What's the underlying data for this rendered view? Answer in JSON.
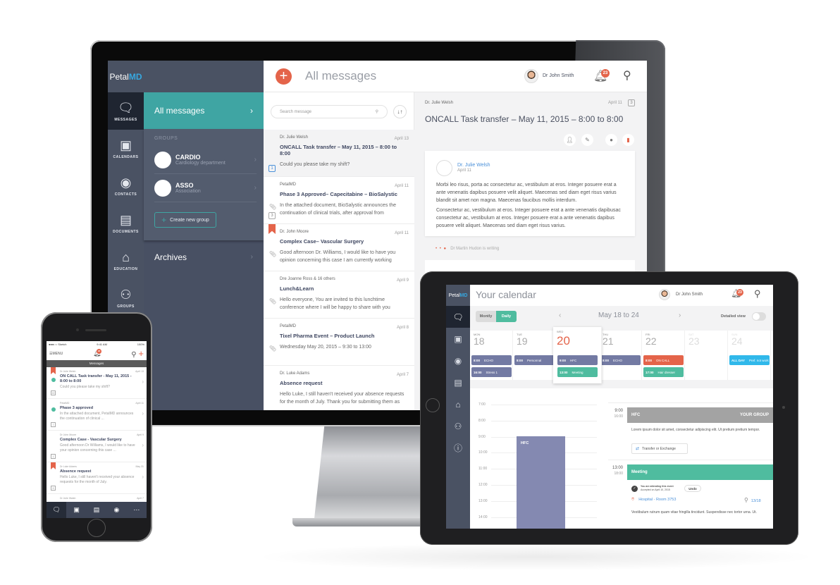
{
  "desktop": {
    "logo": {
      "petal": "Petal",
      "md": "MD"
    },
    "rail": [
      {
        "icon": "chat-bubbles-icon",
        "glyph": "💬",
        "label": "MESSAGES",
        "active": true
      },
      {
        "icon": "calendar-icon",
        "glyph": "📅",
        "label": "CALENDARS"
      },
      {
        "icon": "contact-icon",
        "glyph": "👤",
        "label": "CONTACTS"
      },
      {
        "icon": "document-icon",
        "glyph": "📄",
        "label": "DOCUMENTS"
      },
      {
        "icon": "graduation-cap-icon",
        "glyph": "🎓",
        "label": "EDUCATION"
      },
      {
        "icon": "groups-icon",
        "glyph": "👥",
        "label": "GROUPS"
      }
    ],
    "nav": {
      "all_messages": "All messages",
      "groups_label": "GROUPS",
      "groups": [
        {
          "name": "CARDIO",
          "sub": "Cardiology department"
        },
        {
          "name": "ASSO",
          "sub": "Association"
        }
      ],
      "create_group": "Create new group",
      "archives": "Archives"
    },
    "header": {
      "title": "All messages",
      "user": "Dr John Smith",
      "notifications": "23"
    },
    "list": {
      "search_placeholder": "Search message",
      "messages": [
        {
          "from": "Dr. Julie Welsh",
          "date": "April 13",
          "subject": "ONCALL Task transfer – May 11, 2015 – 8:00 to 8:00",
          "body": "Could you please take my shift?",
          "count": "1",
          "selected": true
        },
        {
          "from": "PetalMD",
          "date": "April 11",
          "subject": "Phase 3 Approved– Capecitabine – BioSalystic",
          "body": "In the attached document, BioSalystic announces the continuation of clinical trials, after approval from",
          "count": "3",
          "attachment": true
        },
        {
          "from": "Dr. John Moore",
          "date": "April 11",
          "subject": "Complex Case– Vascular Surgery",
          "body": "Good afternoon Dr. Williams, I would like to have you opinion concerning this case I am currently working",
          "attachment": true,
          "bookmarked": true
        },
        {
          "from": "Dre Joanne Ross & 16 others",
          "date": "April 9",
          "subject": "Lunch&Learn",
          "body": "Hello everyone, You are invited to this lunchtime conference where  I will be happy to share with you",
          "attachment": true
        },
        {
          "from": "PetalMD",
          "date": "April 8",
          "subject": "Tixel Pharma Event – Product Launch",
          "body": "Wednesday May 20, 2015 – 9:30 to 13:00",
          "attachment": true
        },
        {
          "from": "Dr. Luke Adams",
          "date": "April 7",
          "subject": "Absence request",
          "body": "Hello Luke, I still haven't received your absence requests for the month of July. Thank you for submitting them as"
        }
      ]
    },
    "detail": {
      "from": "Dr. Julie Welsh",
      "date": "April 11",
      "count": "3",
      "title": "ONCALL Task transfer – May 11, 2015 – 8:00 to 8:00",
      "card": {
        "author": "Dr. Julie Welsh",
        "date": "April 11",
        "p1": "Morbi leo risus, porta ac consectetur ac, vestibulum at eros. Integer posuere erat a ante venenatis dapibus posuere velit aliquet. Maecenas sed diam eget risus varius blandit sit amet non magna. Maecenas faucibus mollis interdum.",
        "p2": "Consectetur ac, vestibulum at eros. Integer posuere erat a ante venenatis dapibusac consectetur ac, vestibulum at eros. Integer posuere erat a ante venenatis dapibus posuere velit aliquet. Maecenas sed diam eget risus varius."
      },
      "writing": "Dr Martin Hudon is writing"
    }
  },
  "tablet": {
    "logo": {
      "petal": "Petal",
      "md": "MD"
    },
    "title": "Your calendar",
    "user": "Dr John Smith",
    "notifications": "23",
    "view_toggle": {
      "monthly": "Montly",
      "daily": "Daily",
      "active": "Daily"
    },
    "range": "May 18 to 24",
    "detailed_view": "Detailed view",
    "days": [
      {
        "name": "MON",
        "date": "18",
        "events": [
          {
            "time": "8:00",
            "label": "ECHO",
            "color": "purple"
          },
          {
            "time": "16:00",
            "label": "Stress 1",
            "color": "purple"
          }
        ]
      },
      {
        "name": "TUE",
        "date": "19",
        "events": [
          {
            "time": "8:00",
            "label": "Personnal",
            "color": "purple"
          }
        ]
      },
      {
        "name": "WED",
        "date": "20",
        "today": true,
        "events": [
          {
            "time": "9:00",
            "label": "HFC",
            "color": "purple"
          },
          {
            "time": "13:00",
            "label": "Meeting",
            "color": "green"
          }
        ]
      },
      {
        "name": "THU",
        "date": "21",
        "events": [
          {
            "time": "8:00",
            "label": "ECHO",
            "color": "purple"
          }
        ]
      },
      {
        "name": "FRI",
        "date": "22",
        "events": [
          {
            "time": "8:00",
            "label": "ON CALL",
            "color": "red"
          },
          {
            "time": "17:00",
            "label": "Hair dresser",
            "color": "green"
          }
        ]
      },
      {
        "name": "SAT",
        "date": "23",
        "weekend": true,
        "events": []
      },
      {
        "name": "SUN",
        "date": "24",
        "weekend": true,
        "events": [
          {
            "time": "ALL DAY",
            "label": "Pref. not work",
            "color": "blue"
          }
        ]
      }
    ],
    "hours": [
      "7:00",
      "8:00",
      "9:00",
      "10:00",
      "11:00",
      "12:00",
      "13:00",
      "14:00"
    ],
    "timeline_event": "HFC",
    "agenda": [
      {
        "start": "9:00",
        "end": "16:00",
        "title": "HFC",
        "group": "YOUR GROUP",
        "text": "Lorem ipsum dolor sit amet, consectetur adipiscing elit. Ut pretium pretium tempor.",
        "action": "Transfer or Exchange"
      },
      {
        "start": "13:00",
        "end": "18:00",
        "title": "Meeting",
        "attending": "You are attending this event",
        "accepted": "Accepted on April 10, 2015",
        "undo": "Undo",
        "location": "Hospital - Room 3753",
        "attendees": "13/18",
        "text": "Vestibulum rutrum quam vitae fringilla tincidunt. Suspendisse nec tortor urna. Ut."
      }
    ]
  },
  "phone": {
    "status": {
      "carrier": "●●●○○ Sketch",
      "time": "9:41 AM",
      "battery": "100%"
    },
    "menu": "MENU",
    "notifications": "23",
    "tab_title": "Messages",
    "messages": [
      {
        "from": "Dr Julie Welsh",
        "date": "April 13",
        "subject": "ON CALL Task transfer - May 11, 2015 - 8:00 to 8:00",
        "body": "Could you please take my shift?",
        "count": "22",
        "unread": true,
        "bookmarked": true
      },
      {
        "from": "PetalMD",
        "date": "April 11",
        "subject": "Phase 3 approved",
        "body": "In the attached document, PetalMD announces the continuation of clinical ...",
        "count": "7",
        "unread": true
      },
      {
        "from": "Dr John Moore",
        "date": "April 9",
        "subject": "Complex Case - Vascular Surgery",
        "body": "Good afternoon Dr Williams, I would like to have your opinion concerning this case ...",
        "count": "1"
      },
      {
        "from": "Dr Luke Adams",
        "date": "May 31",
        "subject": "Absence request",
        "body": "Hello Luke, I still haven't received your absence requests for the month of July.",
        "count": "9",
        "bookmarked": true
      },
      {
        "from": "Dr Julie Walsh",
        "date": "April 7",
        "subject": "",
        "body": ""
      }
    ],
    "tabs": [
      "messages-icon",
      "calendar-icon",
      "document-icon",
      "contact-icon",
      "more-icon"
    ]
  },
  "colors": {
    "accent_teal": "#3fa5a3",
    "accent_red": "#e4644a",
    "accent_green": "#4fbc9f",
    "event_purple": "#737aa3",
    "sidebar": "#4a5263",
    "link_blue": "#4a90d9"
  }
}
